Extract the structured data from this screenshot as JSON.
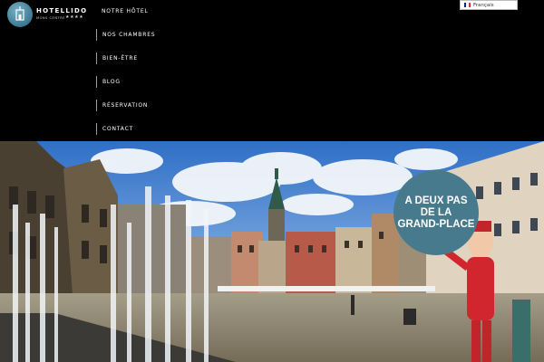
{
  "header": {
    "logo": {
      "name": "HOTELLIDO",
      "subtitle": "MONS CENTRE",
      "stars": "★★★★"
    },
    "nav": [
      {
        "label": "NOTRE HÔTEL"
      },
      {
        "label": "NOS CHAMBRES"
      },
      {
        "label": "BIEN-ÊTRE"
      },
      {
        "label": "BLOG"
      },
      {
        "label": "RÉSERVATION"
      },
      {
        "label": "CONTACT"
      }
    ],
    "language": {
      "selected": "Français",
      "flag_colors": [
        "#002395",
        "#ffffff",
        "#ed2939"
      ]
    }
  },
  "hero": {
    "badge_lines": [
      "A DEUX PAS",
      "DE LA",
      "GRAND-PLACE"
    ],
    "badge_color": "#477a8c"
  }
}
